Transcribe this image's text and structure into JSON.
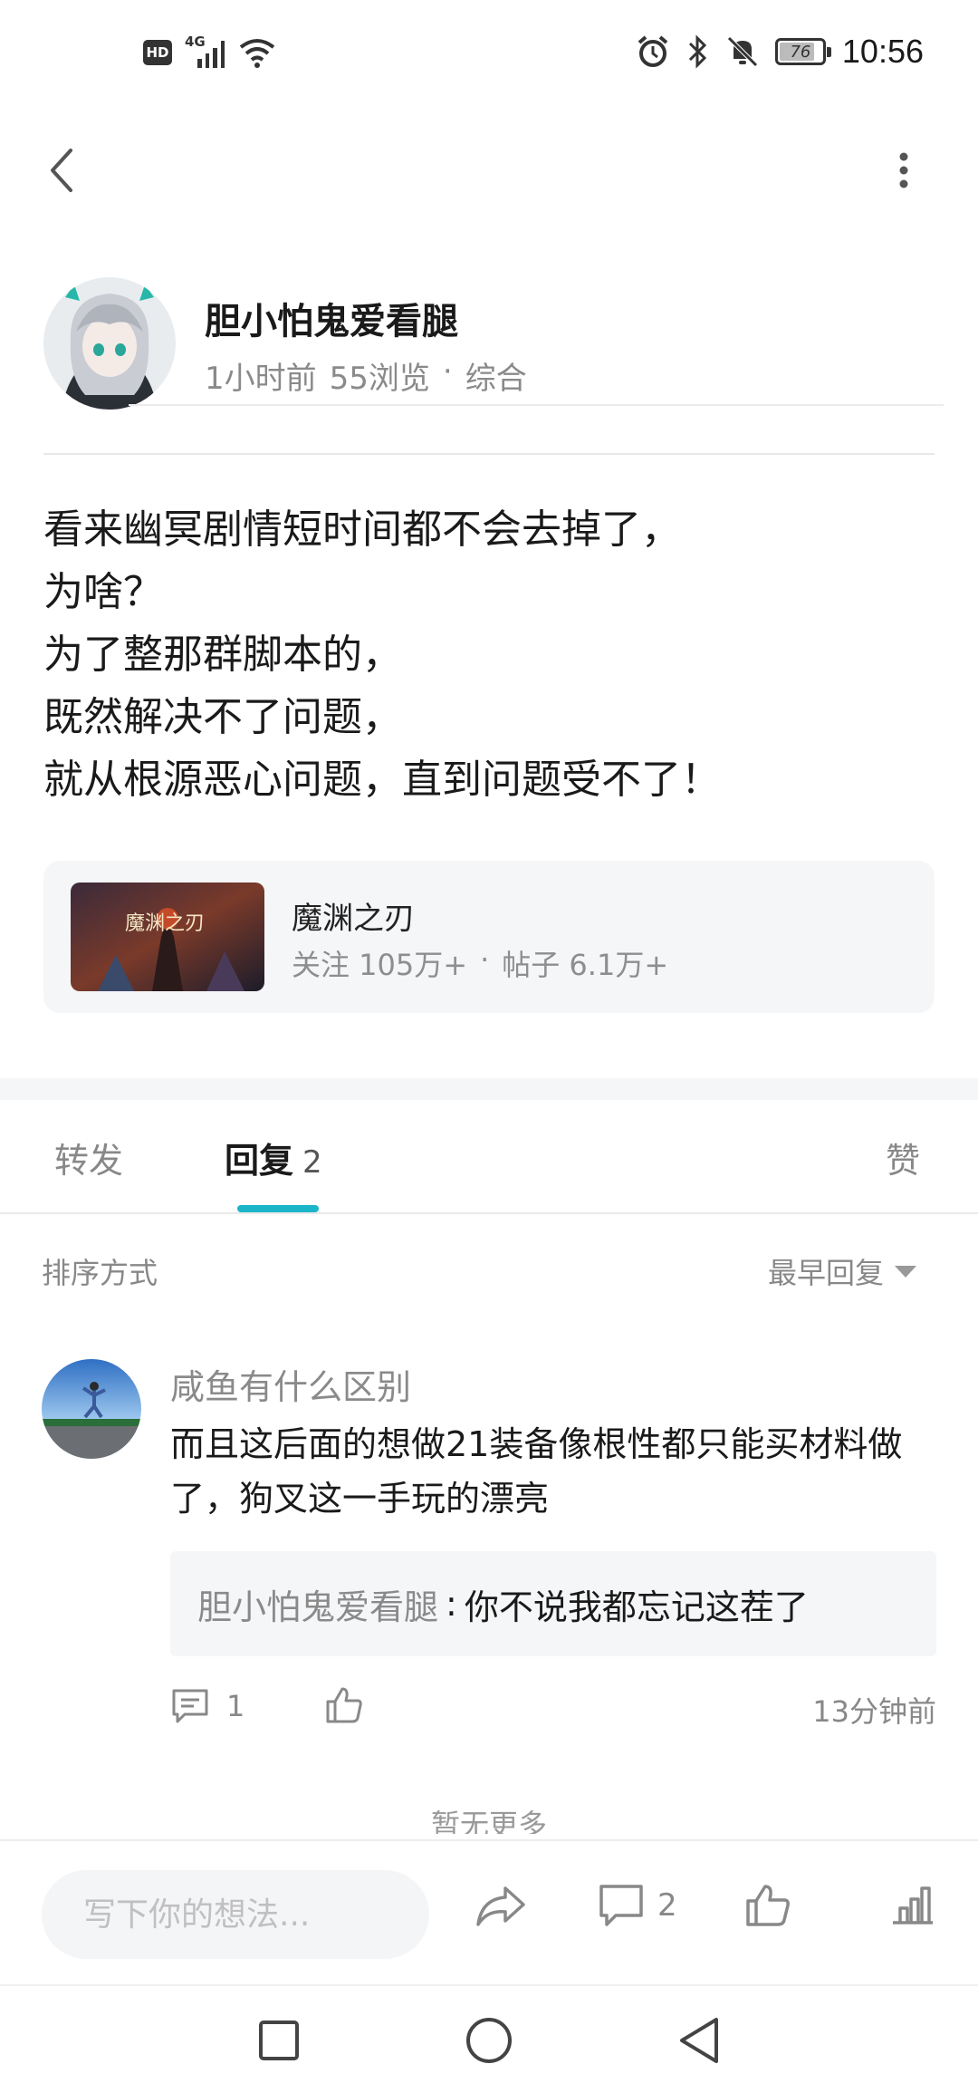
{
  "status_bar": {
    "hd": "HD",
    "network": "4G",
    "battery": "76",
    "time": "10:56",
    "icons": [
      "signal-icon",
      "wifi-icon",
      "alarm-icon",
      "bluetooth-icon",
      "mute-icon",
      "battery-icon"
    ]
  },
  "author": {
    "name": "胆小怕鬼爱看腿",
    "time_ago": "1小时前",
    "views": "55浏览",
    "dot": "·",
    "category": "综合"
  },
  "post": {
    "lines": [
      "看来幽冥剧情短时间都不会去掉了，",
      "为啥？",
      "为了整那群脚本的，",
      "既然解决不了问题，",
      "就从根源恶心问题，直到问题受不了！"
    ]
  },
  "game": {
    "title": "魔渊之刃",
    "followers": "关注 105万+",
    "dot": "·",
    "posts": "帖子 6.1万+",
    "cover_text": "魔渊之刃"
  },
  "tabs": {
    "forward": "转发",
    "reply": "回复",
    "reply_count": "2",
    "like": "赞"
  },
  "sort": {
    "label": "排序方式",
    "selected": "最早回复"
  },
  "comment": {
    "user": "咸鱼有什么区别",
    "text": "而且这后面的想做21装备像根性都只能买材料做了，狗叉这一手玩的漂亮",
    "quote_user": "胆小怕鬼爱看腿",
    "quote_sep": ":",
    "quote_text": "你不说我都忘记这茬了",
    "reply_count": "1",
    "time": "13分钟前"
  },
  "footer_note": "暂无更多",
  "bottom_bar": {
    "placeholder": "写下你的想法...",
    "comment_count": "2"
  },
  "colors": {
    "accent": "#1bb5c9",
    "muted": "#8a8a8a",
    "card_bg": "#f5f6f8"
  }
}
